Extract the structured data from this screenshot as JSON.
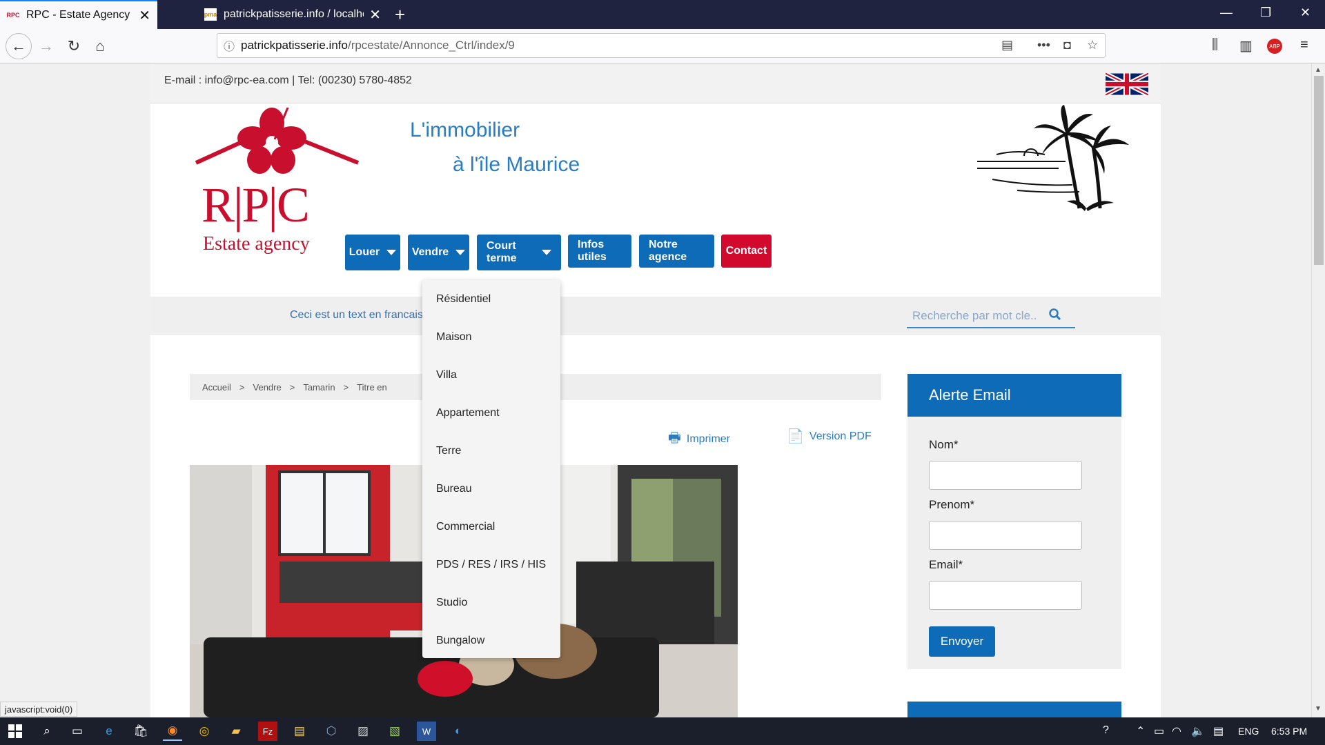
{
  "browser": {
    "tabs": [
      {
        "title": "RPC - Estate Agency",
        "active": true
      },
      {
        "title": "patrickpatisserie.info / localhos",
        "active": false
      }
    ],
    "url_host": "patrickpatisserie.info",
    "url_path": "/rpcestate/Annonce_Ctrl/index/9",
    "status_text": "javascript:void(0)"
  },
  "header": {
    "contact": "E-mail : info@rpc-ea.com | Tel: (00230) 5780-4852",
    "tagline_line1": "L'immobilier",
    "tagline_line2": "à l'île Maurice",
    "logo_text_main": "R|P|C",
    "logo_text_sub": "Estate agency"
  },
  "menu": {
    "items": [
      {
        "label": "Louer",
        "has_caret": true
      },
      {
        "label": "Vendre",
        "has_caret": true
      },
      {
        "label": "Court terme",
        "has_caret": true
      },
      {
        "label": "Infos utiles",
        "has_caret": false
      },
      {
        "label": "Notre agence",
        "has_caret": false
      },
      {
        "label": "Contact",
        "has_caret": false
      }
    ],
    "dropdown": [
      "Résidentiel",
      "Maison",
      "Villa",
      "Appartement",
      "Terre",
      "Bureau",
      "Commercial",
      "PDS / RES / IRS / HIS",
      "Studio",
      "Bungalow"
    ]
  },
  "strip": {
    "marquee": "Ceci est un text en francais",
    "search_placeholder": "Recherche par mot cle.."
  },
  "breadcrumb": [
    "Accueil",
    "Vendre",
    "Tamarin",
    "Titre en"
  ],
  "actions": {
    "print": "Imprimer",
    "pdf": "Version PDF"
  },
  "alert": {
    "title": "Alerte Email",
    "name_label": "Nom*",
    "firstname_label": "Prenom*",
    "email_label": "Email*",
    "send": "Envoyer"
  },
  "taskbar": {
    "lang": "ENG",
    "time": "6:53 PM"
  },
  "colors": {
    "brand_blue": "#0e6bb8",
    "contact_red": "#d10a2d",
    "logo_red": "#c8102e",
    "tagline_blue": "#2a7cc0"
  }
}
